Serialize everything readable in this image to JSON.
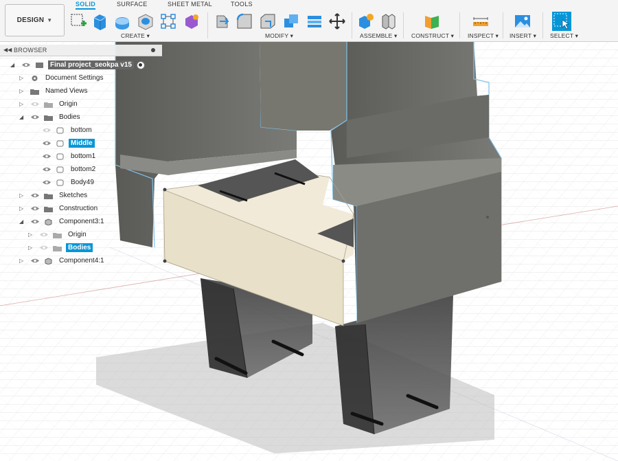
{
  "toolbar": {
    "workspace": "DESIGN",
    "tabs": [
      "SOLID",
      "SURFACE",
      "SHEET METAL",
      "TOOLS"
    ],
    "groups": [
      "CREATE",
      "MODIFY",
      "ASSEMBLE",
      "CONSTRUCT",
      "INSPECT",
      "INSERT",
      "SELECT"
    ]
  },
  "browser": {
    "title": "BROWSER",
    "root": "Final project_seokpa v15",
    "items": [
      {
        "label": "Document Settings",
        "type": "gear",
        "selected": false
      },
      {
        "label": "Named Views",
        "type": "folder",
        "selected": false
      },
      {
        "label": "Origin",
        "type": "folder",
        "selected": false
      },
      {
        "label": "Bodies",
        "type": "folder",
        "selected": false
      },
      {
        "label": "bottom",
        "type": "body",
        "selected": false
      },
      {
        "label": "Middle",
        "type": "body",
        "selected": true
      },
      {
        "label": "bottom1",
        "type": "body",
        "selected": false
      },
      {
        "label": "bottom2",
        "type": "body",
        "selected": false
      },
      {
        "label": "Body49",
        "type": "body",
        "selected": false
      },
      {
        "label": "Sketches",
        "type": "folder",
        "selected": false
      },
      {
        "label": "Construction",
        "type": "folder",
        "selected": false
      },
      {
        "label": "Component3:1",
        "type": "component",
        "selected": false
      },
      {
        "label": "Origin",
        "type": "folder",
        "selected": false
      },
      {
        "label": "Bodies",
        "type": "folder",
        "selected": true
      },
      {
        "label": "Component4:1",
        "type": "component",
        "selected": false
      }
    ]
  },
  "colors": {
    "accent": "#0696d7",
    "body": "#6f6f6b",
    "highlight": "#f1ead8"
  }
}
